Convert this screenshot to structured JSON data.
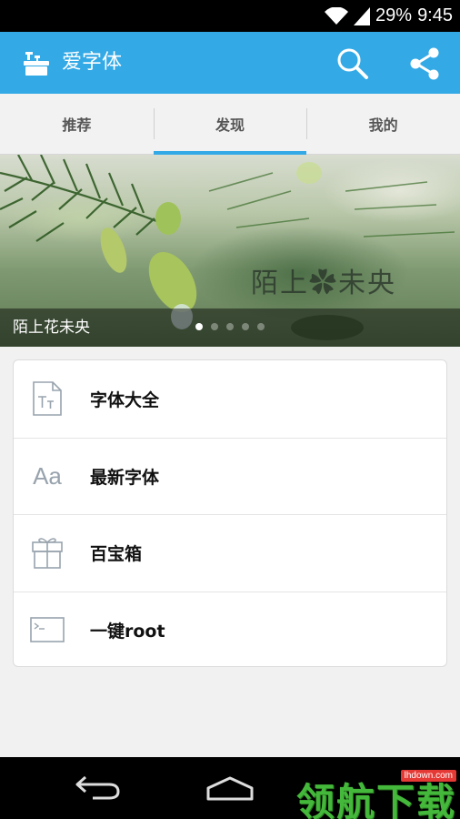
{
  "status_bar": {
    "battery": "29%",
    "time": "9:45"
  },
  "app_bar": {
    "title": "爱字体",
    "icons": [
      "app-logo-icon",
      "search-icon",
      "share-icon"
    ]
  },
  "tabs": [
    {
      "label": "推荐",
      "active": false
    },
    {
      "label": "发现",
      "active": true
    },
    {
      "label": "我的",
      "active": false
    }
  ],
  "banner": {
    "title": "陌上花未央",
    "art_text": "陌上✿未央",
    "slide_count": 5,
    "active_slide": 1
  },
  "menu": {
    "items": [
      {
        "label": "字体大全",
        "icon": "font-file-icon"
      },
      {
        "label": "最新字体",
        "icon": "aa-font-icon",
        "icon_text": "Aa"
      },
      {
        "label": "百宝箱",
        "icon": "gift-box-icon"
      },
      {
        "label": "一键root",
        "icon": "terminal-icon"
      }
    ]
  },
  "watermark": {
    "text": "领航下载",
    "url": "lhdown.com"
  },
  "colors": {
    "primary": "#33a9e6",
    "background": "#f1f1f1",
    "watermark": "#44b83a"
  }
}
